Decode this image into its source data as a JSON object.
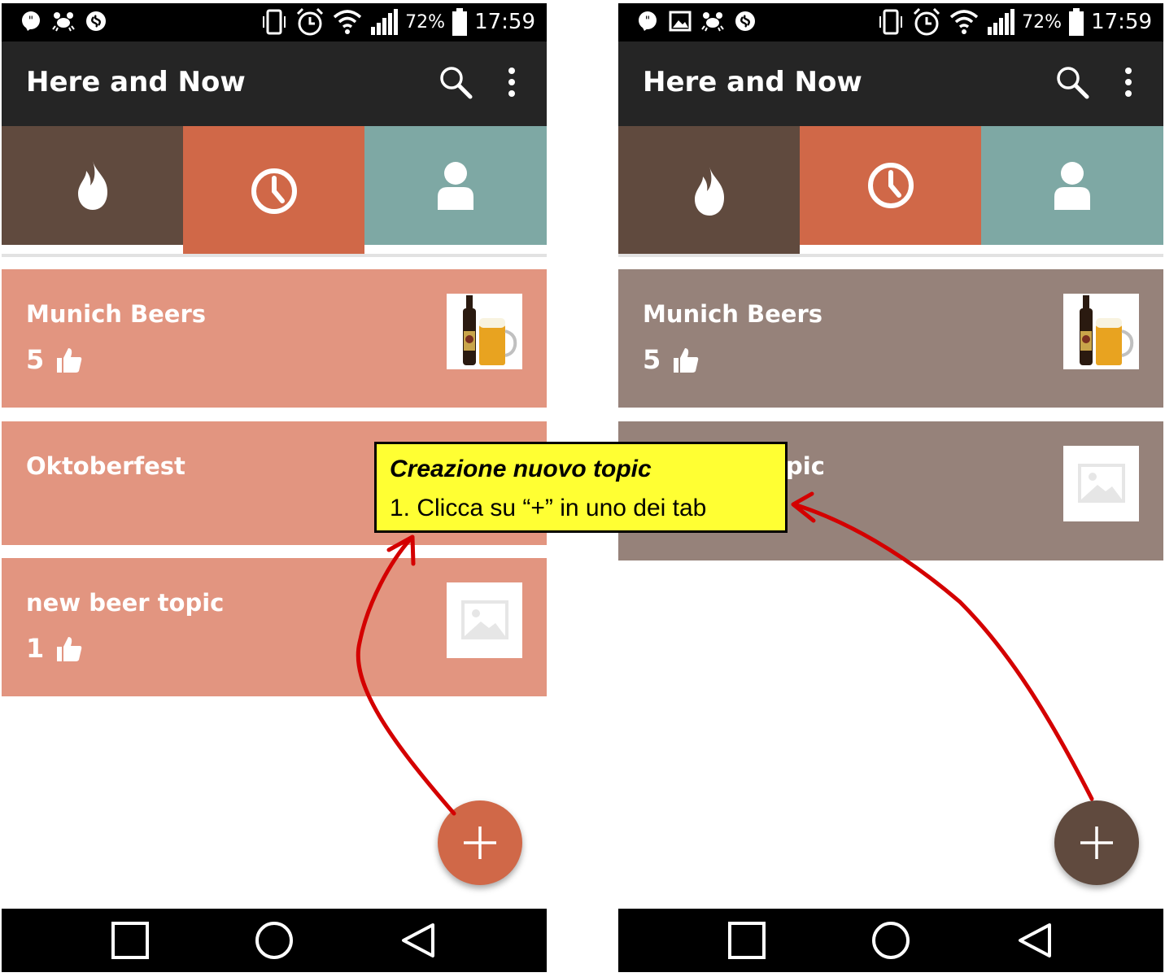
{
  "status_bar": {
    "battery_percent": "72%",
    "time": "17:59"
  },
  "app": {
    "title": "Here and Now"
  },
  "colors": {
    "brown": "#604a3e",
    "orange": "#d06848",
    "teal": "#7ea8a4",
    "card_orange": "#e29580",
    "card_brown": "#96827a"
  },
  "icons": {
    "tabs": [
      "flame-icon",
      "clock-icon",
      "person-icon"
    ],
    "appbar": [
      "search-icon",
      "overflow-menu-icon"
    ],
    "navigation": [
      "recents-icon",
      "home-icon",
      "back-icon"
    ],
    "fab": "plus-icon"
  },
  "left_screen": {
    "selected_tab": "clock",
    "topics": [
      {
        "title": "Munich Beers",
        "likes": "5",
        "image": "beer-photo"
      },
      {
        "title": "Oktoberfest",
        "likes": "",
        "image": ""
      },
      {
        "title": "new beer topic",
        "likes": "1",
        "image": "image-placeholder"
      }
    ]
  },
  "right_screen": {
    "selected_tab": "flame",
    "topics": [
      {
        "title": "Munich Beers",
        "likes": "5",
        "image": "beer-photo"
      },
      {
        "title": "pic",
        "likes": "",
        "image": "image-placeholder"
      }
    ]
  },
  "callout": {
    "title": "Creazione nuovo topic",
    "body": "1. Clicca su “+” in uno dei tab"
  }
}
